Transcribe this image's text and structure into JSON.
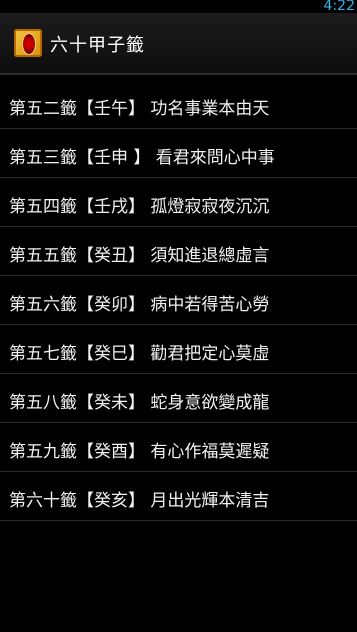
{
  "status_bar": {
    "time": "4:22"
  },
  "action_bar": {
    "title": "六十甲子籤"
  },
  "lots": [
    {
      "label": "第五二籤【壬午】 功名事業本由天"
    },
    {
      "label": "第五三籤【壬申 】 看君來問心中事"
    },
    {
      "label": "第五四籤【壬戌】 孤燈寂寂夜沉沉"
    },
    {
      "label": "第五五籤【癸丑】 須知進退總虛言"
    },
    {
      "label": "第五六籤【癸卯】 病中若得苦心勞"
    },
    {
      "label": "第五七籤【癸巳】 勸君把定心莫虛"
    },
    {
      "label": "第五八籤【癸未】 蛇身意欲變成龍"
    },
    {
      "label": "第五九籤【癸酉】 有心作福莫遲疑"
    },
    {
      "label": "第六十籤【癸亥】 月出光輝本清吉"
    }
  ]
}
